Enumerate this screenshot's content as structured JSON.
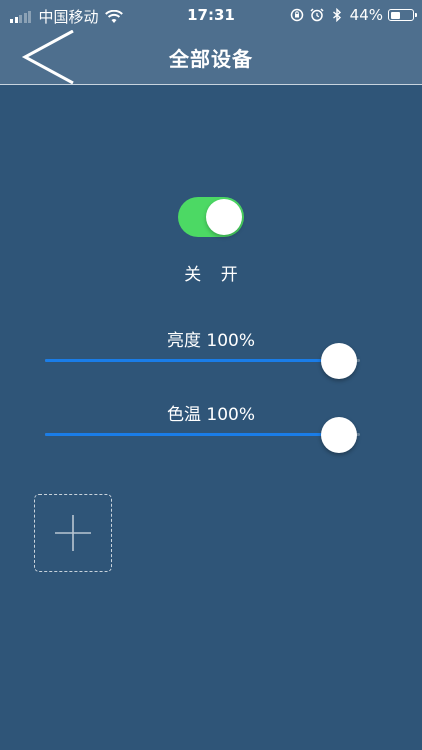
{
  "status_bar": {
    "carrier": "中国移动",
    "time": "17:31",
    "battery_percent": "44%",
    "battery_level": 0.44,
    "icons": [
      "signal-icon",
      "wifi-icon",
      "rotation-lock-icon",
      "alarm-icon",
      "bluetooth-icon",
      "battery-icon"
    ]
  },
  "nav": {
    "title": "全部设备",
    "back_icon": "chevron-left-icon"
  },
  "power": {
    "on": true,
    "labels": "关 开",
    "on_color": "#4cd964"
  },
  "brightness": {
    "label": "亮度 100%",
    "value": 1.0
  },
  "color_temp": {
    "label": "色温 100%",
    "value": 1.0
  },
  "add": {
    "icon": "plus-icon"
  },
  "colors": {
    "background": "#2f5578",
    "header": "#4e6f8e",
    "slider_fill": "#1a7de8"
  }
}
